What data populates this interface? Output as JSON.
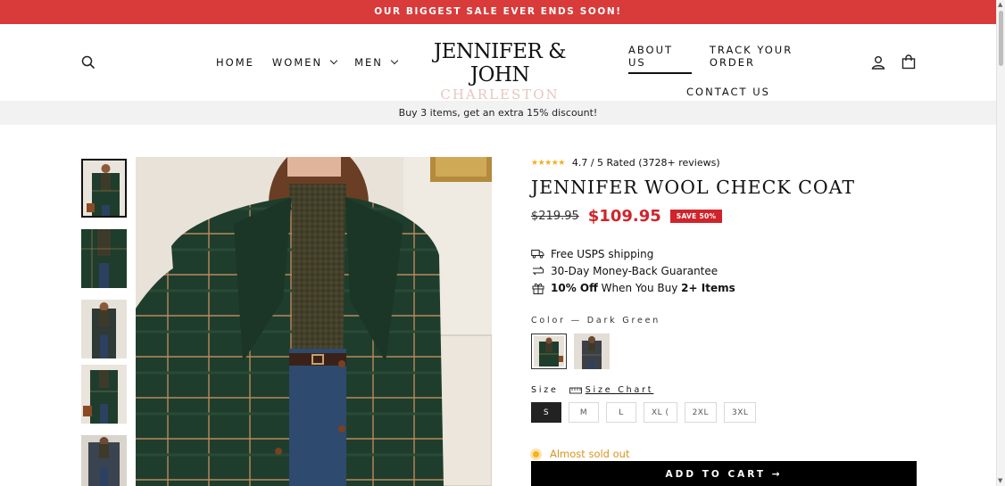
{
  "announcement": "OUR BIGGEST SALE EVER ENDS SOON!",
  "header": {
    "nav_left": [
      {
        "label": "HOME"
      },
      {
        "label": "WOMEN"
      },
      {
        "label": "MEN"
      }
    ],
    "logo": {
      "line1": "JENNIFER & JOHN",
      "line2": "CHARLESTON"
    },
    "nav_right": {
      "about": "ABOUT US",
      "track": "TRACK YOUR ORDER",
      "contact": "CONTACT US"
    },
    "icons": [
      "search-icon",
      "account-icon",
      "cart-icon"
    ]
  },
  "promo": "Buy 3 items, get an extra 15% discount!",
  "product": {
    "rating_text": "4.7 / 5 Rated (3728+ reviews)",
    "stars": "★★★★★",
    "title": "JENNIFER WOOL CHECK COAT",
    "old_price": "$219.95",
    "price": "$109.95",
    "save_badge": "SAVE 50%",
    "perks": {
      "shipping": "Free USPS shipping",
      "guarantee": "30-Day Money-Back Guarantee",
      "discount_bold": "10% Off",
      "discount_mid": " When You Buy ",
      "discount_bold2": "2+ Items"
    },
    "color_label": "Color — Dark Green",
    "size_label": "Size",
    "size_chart": "Size Chart",
    "sizes": [
      "S",
      "M",
      "L",
      "XL (",
      "2XL",
      "3XL"
    ],
    "selected_size": "S",
    "stock": "Almost sold out",
    "add_to_cart": "ADD TO CART →"
  },
  "colors": {
    "announce_bg": "#d93a3a",
    "price_red": "#d0242c",
    "coat_green": "#1f3d2c",
    "stock_orange": "#d9941c"
  }
}
